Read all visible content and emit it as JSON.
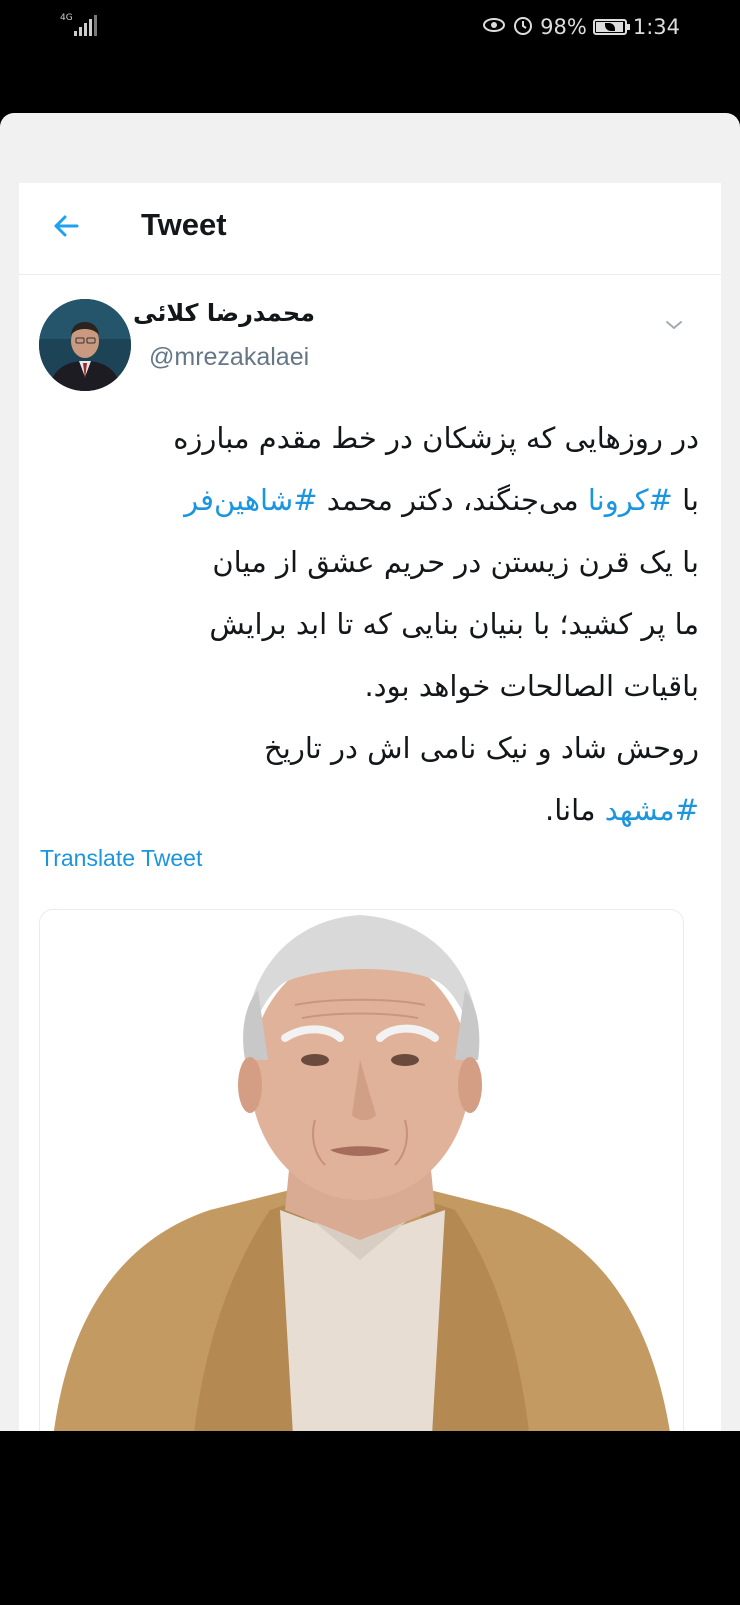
{
  "status_bar": {
    "network": "4G",
    "battery": "98%",
    "battery_level": 0.98,
    "time": "1:34",
    "icons": [
      "eye-comfort-icon",
      "alarm-icon",
      "battery-icon",
      "signal-icon"
    ]
  },
  "header": {
    "back_icon": "arrow-left-icon",
    "title": "Tweet"
  },
  "tweet": {
    "display_name": "محمدرضا کلائی",
    "handle": "@mrezakalaei",
    "caret_icon": "chevron-down-icon",
    "line1": "در روزهایی که پزشکان در خط مقدم مبارزه",
    "line2_a": "با ",
    "hashtag_corona": "#کرونا",
    "line2_b": " می‌جنگند، دکتر محمد ",
    "hashtag_shahinfar": "#شاهین‌فر",
    "line3": "با یک قرن زیستن در حریم عشق از میان",
    "line4": "ما پر کشید؛ با بنیان بنایی که تا ابد برایش",
    "line5": "باقیات الصالحات خواهد بود.",
    "line6": "روحش شاد و نیک نامی اش در تاریخ",
    "hashtag_mashhad": "#مشهد",
    "line7_b": " مانا."
  },
  "translate_label": "Translate Tweet",
  "colors": {
    "link": "#1b95e0",
    "text": "#14171a",
    "secondary": "#657786"
  }
}
